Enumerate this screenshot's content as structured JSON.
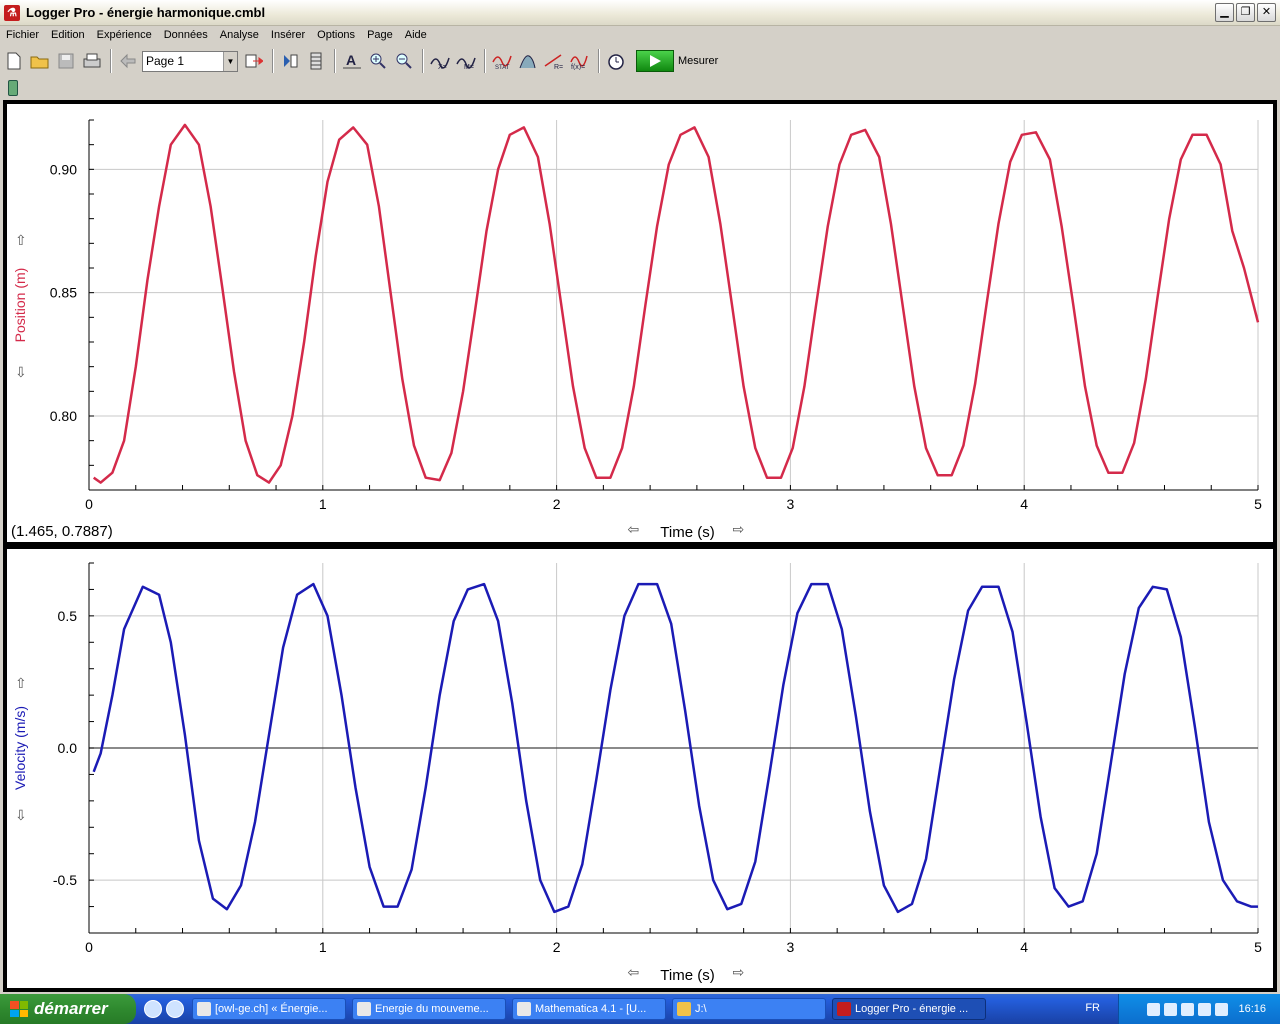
{
  "window": {
    "app_icon": "logger-pro-icon",
    "title": "Logger Pro - énergie harmonique.cmbl",
    "buttons": [
      "minimize-icon",
      "restore-icon",
      "close-icon"
    ]
  },
  "menu": [
    "Fichier",
    "Edition",
    "Expérience",
    "Données",
    "Analyse",
    "Insérer",
    "Options",
    "Page",
    "Aide"
  ],
  "toolbar": {
    "page_select": "Page 1",
    "collect_label": "Mesurer"
  },
  "graph1": {
    "ylabel": "Position (m)",
    "xlabel": "Time (s)",
    "readout": "(1.465, 0.7887)",
    "color": "#d42a4a"
  },
  "graph2": {
    "ylabel": "Velocity (m/s)",
    "xlabel": "Time (s)",
    "color": "#1b1bb5"
  },
  "chart_data": [
    {
      "type": "line",
      "title": "",
      "xlabel": "Time (s)",
      "ylabel": "Position (m)",
      "xlim": [
        0,
        5
      ],
      "ylim": [
        0.77,
        0.92
      ],
      "xticks": [
        "0",
        "1",
        "2",
        "3",
        "4",
        "5"
      ],
      "yticks": [
        "0.80",
        "0.85",
        "0.90"
      ],
      "grid": true,
      "series": [
        {
          "color": "#d42a4a",
          "x": [
            0.02,
            0.05,
            0.1,
            0.15,
            0.2,
            0.25,
            0.3,
            0.35,
            0.41,
            0.47,
            0.52,
            0.57,
            0.62,
            0.67,
            0.72,
            0.77,
            0.82,
            0.87,
            0.92,
            0.97,
            1.02,
            1.07,
            1.13,
            1.19,
            1.24,
            1.29,
            1.34,
            1.39,
            1.44,
            1.5,
            1.55,
            1.6,
            1.65,
            1.7,
            1.75,
            1.8,
            1.86,
            1.92,
            1.97,
            2.02,
            2.07,
            2.12,
            2.17,
            2.23,
            2.28,
            2.33,
            2.38,
            2.43,
            2.48,
            2.53,
            2.59,
            2.65,
            2.7,
            2.75,
            2.8,
            2.85,
            2.9,
            2.96,
            3.01,
            3.06,
            3.11,
            3.16,
            3.21,
            3.26,
            3.32,
            3.38,
            3.43,
            3.48,
            3.53,
            3.58,
            3.63,
            3.69,
            3.74,
            3.79,
            3.84,
            3.89,
            3.94,
            3.99,
            4.05,
            4.11,
            4.16,
            4.21,
            4.26,
            4.31,
            4.36,
            4.42,
            4.47,
            4.52,
            4.57,
            4.62,
            4.67,
            4.72,
            4.78,
            4.84,
            4.89,
            4.94,
            5.0
          ],
          "y": [
            0.775,
            0.773,
            0.777,
            0.79,
            0.82,
            0.855,
            0.885,
            0.91,
            0.918,
            0.91,
            0.885,
            0.852,
            0.818,
            0.79,
            0.776,
            0.773,
            0.78,
            0.8,
            0.83,
            0.865,
            0.895,
            0.912,
            0.917,
            0.91,
            0.885,
            0.85,
            0.815,
            0.788,
            0.775,
            0.774,
            0.785,
            0.81,
            0.842,
            0.875,
            0.9,
            0.914,
            0.917,
            0.905,
            0.878,
            0.845,
            0.812,
            0.787,
            0.775,
            0.775,
            0.787,
            0.812,
            0.845,
            0.877,
            0.902,
            0.914,
            0.917,
            0.905,
            0.878,
            0.845,
            0.812,
            0.787,
            0.775,
            0.775,
            0.787,
            0.812,
            0.845,
            0.877,
            0.902,
            0.914,
            0.916,
            0.905,
            0.878,
            0.845,
            0.812,
            0.787,
            0.776,
            0.776,
            0.788,
            0.813,
            0.846,
            0.878,
            0.903,
            0.914,
            0.915,
            0.904,
            0.877,
            0.845,
            0.812,
            0.788,
            0.777,
            0.777,
            0.789,
            0.815,
            0.848,
            0.88,
            0.904,
            0.914,
            0.914,
            0.902,
            0.875,
            0.86,
            0.838
          ]
        }
      ]
    },
    {
      "type": "line",
      "title": "",
      "xlabel": "Time (s)",
      "ylabel": "Velocity (m/s)",
      "xlim": [
        0,
        5
      ],
      "ylim": [
        -0.7,
        0.7
      ],
      "xticks": [
        "0",
        "1",
        "2",
        "3",
        "4",
        "5"
      ],
      "yticks": [
        "-0.5",
        "0.0",
        "0.5"
      ],
      "grid": true,
      "series": [
        {
          "color": "#1b1bb5",
          "x": [
            0.02,
            0.05,
            0.1,
            0.15,
            0.23,
            0.3,
            0.35,
            0.41,
            0.47,
            0.53,
            0.59,
            0.65,
            0.71,
            0.77,
            0.83,
            0.89,
            0.96,
            1.02,
            1.08,
            1.14,
            1.2,
            1.26,
            1.32,
            1.38,
            1.44,
            1.5,
            1.56,
            1.62,
            1.69,
            1.75,
            1.81,
            1.87,
            1.93,
            1.99,
            2.05,
            2.11,
            2.17,
            2.23,
            2.29,
            2.35,
            2.43,
            2.49,
            2.55,
            2.61,
            2.67,
            2.73,
            2.79,
            2.85,
            2.91,
            2.97,
            3.03,
            3.09,
            3.16,
            3.22,
            3.28,
            3.34,
            3.4,
            3.46,
            3.52,
            3.58,
            3.64,
            3.7,
            3.76,
            3.82,
            3.89,
            3.95,
            4.01,
            4.07,
            4.13,
            4.19,
            4.25,
            4.31,
            4.37,
            4.43,
            4.49,
            4.55,
            4.61,
            4.67,
            4.73,
            4.79,
            4.85,
            4.91,
            4.97,
            5.0
          ],
          "y": [
            -0.09,
            -0.02,
            0.2,
            0.45,
            0.61,
            0.58,
            0.4,
            0.05,
            -0.35,
            -0.57,
            -0.61,
            -0.52,
            -0.28,
            0.05,
            0.38,
            0.58,
            0.62,
            0.5,
            0.2,
            -0.15,
            -0.45,
            -0.6,
            -0.6,
            -0.46,
            -0.15,
            0.2,
            0.48,
            0.6,
            0.62,
            0.48,
            0.17,
            -0.2,
            -0.5,
            -0.62,
            -0.6,
            -0.44,
            -0.12,
            0.22,
            0.5,
            0.62,
            0.62,
            0.47,
            0.14,
            -0.22,
            -0.5,
            -0.61,
            -0.59,
            -0.43,
            -0.1,
            0.24,
            0.51,
            0.62,
            0.62,
            0.45,
            0.12,
            -0.24,
            -0.52,
            -0.62,
            -0.59,
            -0.42,
            -0.08,
            0.26,
            0.52,
            0.61,
            0.61,
            0.44,
            0.1,
            -0.26,
            -0.53,
            -0.6,
            -0.58,
            -0.4,
            -0.06,
            0.28,
            0.53,
            0.61,
            0.6,
            0.42,
            0.08,
            -0.28,
            -0.5,
            -0.58,
            -0.6,
            -0.6
          ]
        }
      ]
    }
  ],
  "taskbar": {
    "start_label": "démarrer",
    "tasks": [
      "[owl-ge.ch] « Énergie...",
      "Energie du mouveme...",
      "Mathematica 4.1 - [U...",
      "J:\\",
      "Logger Pro - énergie ..."
    ],
    "language": "FR",
    "clock": "16:16"
  }
}
